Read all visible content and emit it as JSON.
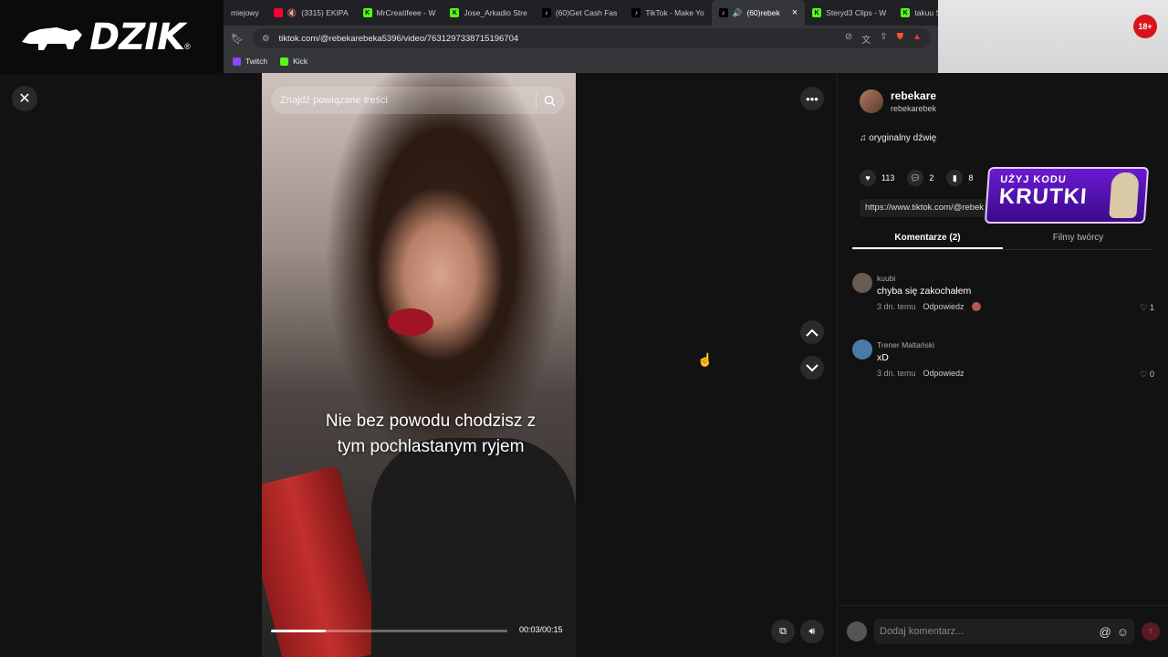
{
  "overlay": {
    "logo_text": "DZIK",
    "logo_reg": "®",
    "age_badge": "18+"
  },
  "browser": {
    "tabs": [
      {
        "label": "miejowy",
        "icon": "generic-favicon"
      },
      {
        "label": "(3315) EKIPA",
        "icon": "youtube-icon"
      },
      {
        "label": "MrCreatifeee - W",
        "icon": "kick-icon"
      },
      {
        "label": "Jose_Arkadio Stre",
        "icon": "kick-icon"
      },
      {
        "label": "(60)Get Cash Fas",
        "icon": "tiktok-icon"
      },
      {
        "label": "TikTok - Make Yo",
        "icon": "tiktok-icon"
      },
      {
        "label": "(60)rebek",
        "icon": "tiktok-icon",
        "active": true
      },
      {
        "label": "Steryd3 Clips - W",
        "icon": "kick-icon"
      },
      {
        "label": "takuu Stream -",
        "icon": "kick-icon"
      }
    ],
    "tab_close": "×",
    "url": "tiktok.com/@rebekarebeka5396/video/7631297338715196704",
    "bookmarks": [
      {
        "label": "Twitch",
        "color": "#9146ff"
      },
      {
        "label": "Kick",
        "color": "#53fc18"
      }
    ]
  },
  "video": {
    "search_placeholder": "Znajdź powiązane treści",
    "caption_line1": "Nie bez powodu chodzisz z",
    "caption_line2": "tym pochlastanym ryjem",
    "time": "00:03/00:15",
    "progress": 0.23
  },
  "panel": {
    "author_name": "rebekare",
    "author_handle": "rebekarebek",
    "sound": "♫  oryginalny dźwię",
    "likes": "113",
    "comments_count": "2",
    "saves": "8",
    "link": "https://www.tiktok.com/@rebek",
    "promo_line1": "UŻYJ KODU",
    "promo_line2": "KRUTKI",
    "tab_comments": "Komentarze (2)",
    "tab_creator": "Filmy twórcy",
    "comments": [
      {
        "user": "kuubi",
        "text": "chyba się zakochałem",
        "time": "3 dn. temu",
        "reply": "Odpowiedz",
        "likes": "1",
        "avatar_color": "#6a5a50"
      },
      {
        "user": "Trener Maltański",
        "text": "xD",
        "time": "3 dn. temu",
        "reply": "Odpowiedz",
        "likes": "0",
        "avatar_color": "#4a7aa8"
      }
    ],
    "composer_placeholder": "Dodaj komentarz..."
  },
  "colors": {
    "accent_red": "#fe2c55",
    "background": "#121212"
  }
}
